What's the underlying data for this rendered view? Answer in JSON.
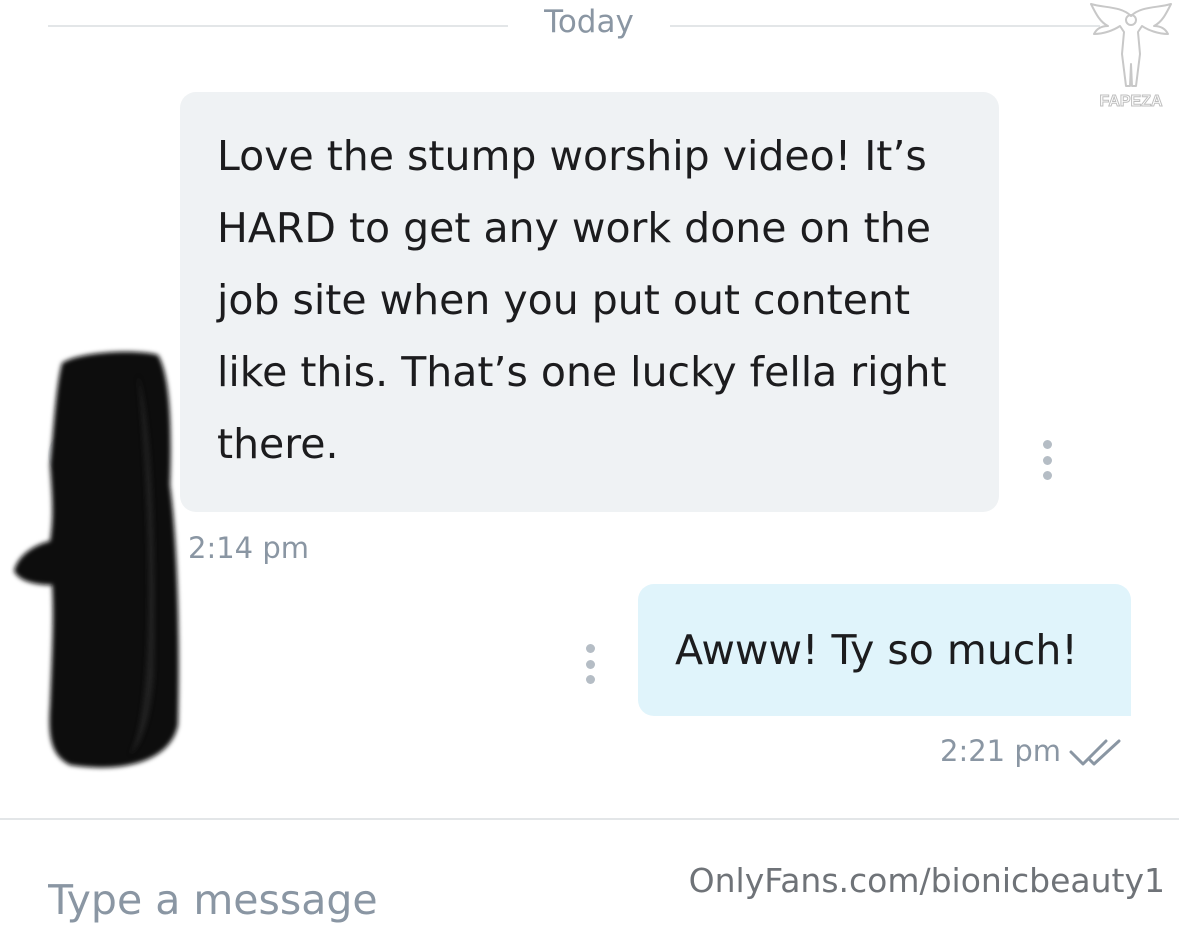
{
  "day_separator": {
    "label": "Today"
  },
  "watermark": {
    "logo_text": "FAPEZA",
    "url": "OnlyFans.com/bionicbeauty1"
  },
  "messages": [
    {
      "direction": "incoming",
      "text": "Love the stump worship video! It’s HARD to get any work done on the job site when you put out content like this. That’s one lucky fella right there.",
      "lines": [
        "Love the stump worship video! It’s",
        "HARD to get any work done on the",
        "job site when you put out content",
        "like this. That’s one lucky fella right",
        "there."
      ],
      "time": "2:14 pm",
      "menu_icon": "more-vertical-icon"
    },
    {
      "direction": "outgoing",
      "text": "Awww! Ty so much!",
      "time": "2:21 pm",
      "status_icon": "double-check-icon",
      "menu_icon": "more-vertical-icon"
    }
  ],
  "composer": {
    "placeholder": "Type a message"
  },
  "colors": {
    "incoming_bubble": "#eff2f4",
    "outgoing_bubble": "#e0f4fb",
    "meta_text": "#8a96a3",
    "divider": "#e3e6e8"
  }
}
